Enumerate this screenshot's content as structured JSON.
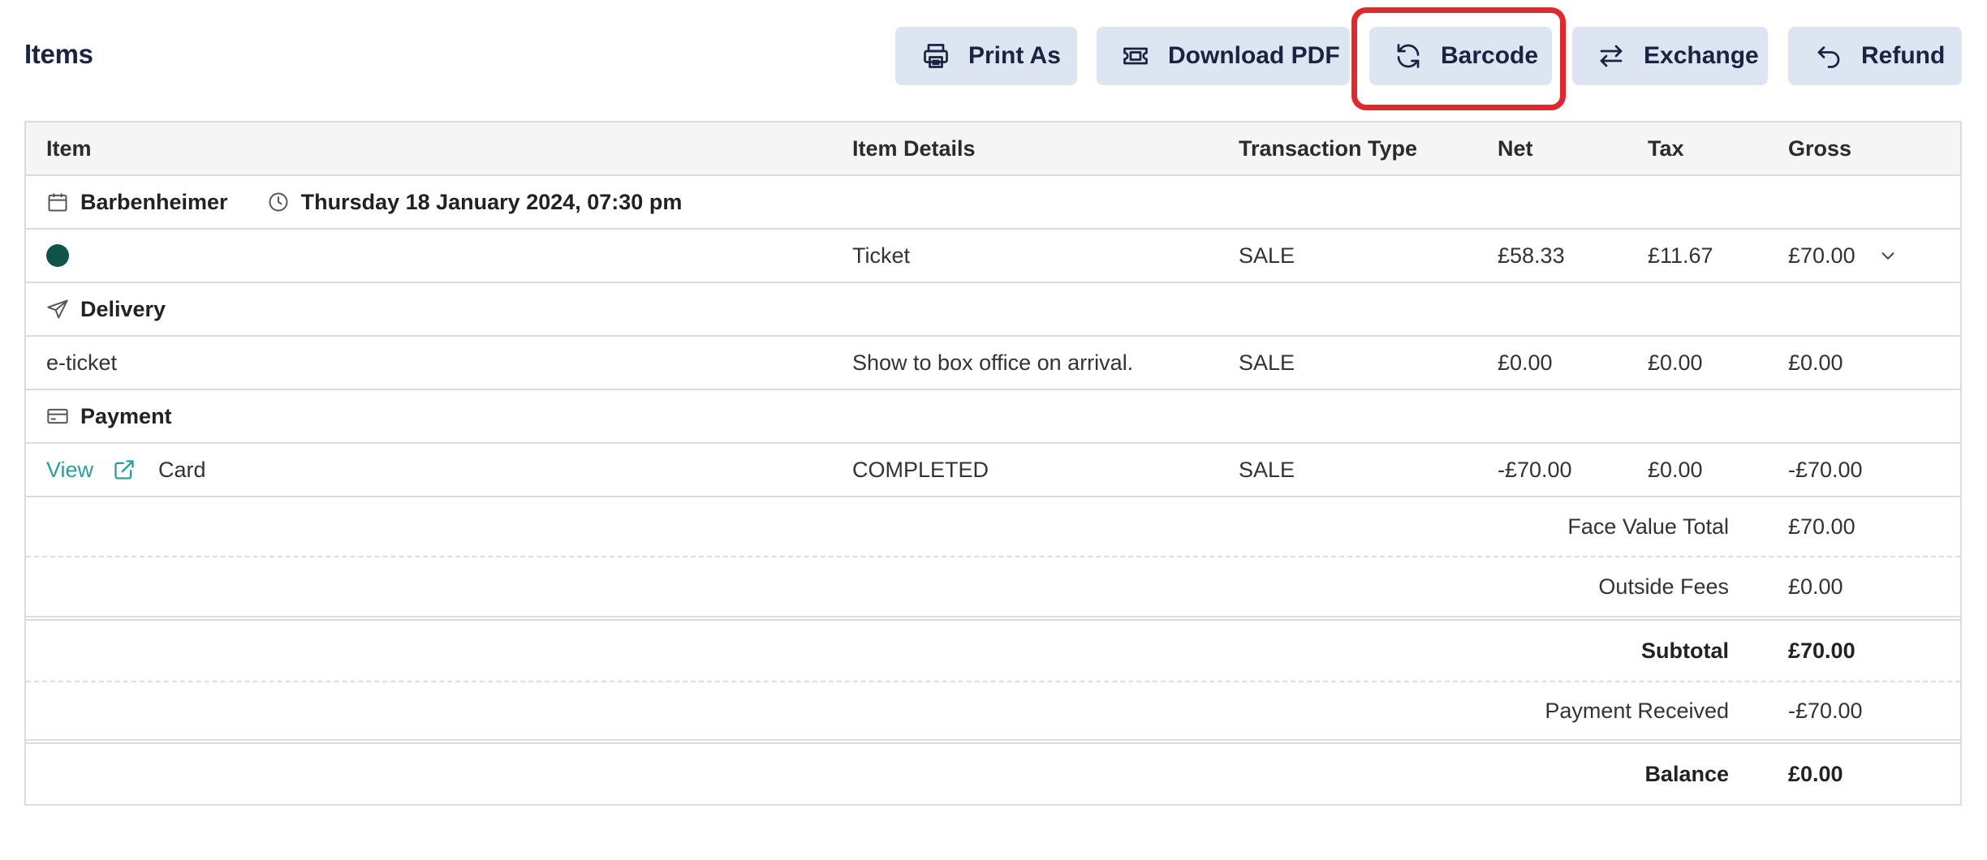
{
  "header": {
    "title": "Items",
    "buttons": {
      "print": "Print As",
      "pdf": "Download PDF",
      "barcode": "Barcode",
      "exchange": "Exchange",
      "refund": "Refund"
    }
  },
  "table": {
    "columns": {
      "item": "Item",
      "details": "Item Details",
      "type": "Transaction Type",
      "net": "Net",
      "tax": "Tax",
      "gross": "Gross"
    },
    "event": {
      "name": "Barbenheimer",
      "datetime": "Thursday 18 January 2024, 07:30 pm"
    },
    "ticket_row": {
      "details": "Ticket",
      "type": "SALE",
      "net": "£58.33",
      "tax": "£11.67",
      "gross": "£70.00"
    },
    "delivery": {
      "label": "Delivery"
    },
    "delivery_row": {
      "item": "e-ticket",
      "details": "Show to box office on arrival.",
      "type": "SALE",
      "net": "£0.00",
      "tax": "£0.00",
      "gross": "£0.00"
    },
    "payment": {
      "label": "Payment"
    },
    "payment_row": {
      "link": "View",
      "method": "Card",
      "details": "COMPLETED",
      "type": "SALE",
      "net": "-£70.00",
      "tax": "£0.00",
      "gross": "-£70.00"
    }
  },
  "summary": {
    "face_value_label": "Face Value Total",
    "face_value": "£70.00",
    "outside_fees_label": "Outside Fees",
    "outside_fees": "£0.00",
    "subtotal_label": "Subtotal",
    "subtotal": "£70.00",
    "payment_received_label": "Payment Received",
    "payment_received": "-£70.00",
    "balance_label": "Balance",
    "balance": "£0.00"
  },
  "colors": {
    "button_bg": "#dde4f2",
    "highlight": "#e0282e",
    "link": "#2a9e9c",
    "dot": "#0e5448"
  }
}
